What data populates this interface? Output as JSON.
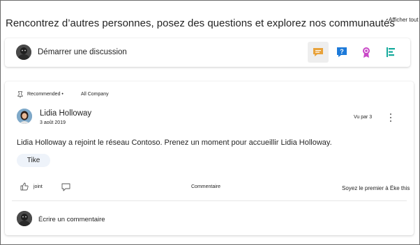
{
  "header": {
    "title": "Rencontrez d’autres personnes, posez des questions et explorez nos communautés",
    "see_all_label": "Afficher tout"
  },
  "composer": {
    "start_discussion_label": "Démarrer une discussion",
    "actions": [
      {
        "name": "discussion-icon",
        "color": "#e8a23a"
      },
      {
        "name": "question-icon",
        "color": "#1d7ad9"
      },
      {
        "name": "praise-icon",
        "color": "#c948c7"
      },
      {
        "name": "poll-icon",
        "color": "#13a99b"
      }
    ]
  },
  "post": {
    "recommended_label": "Recommended •",
    "group_label": "All Company",
    "author_name": "Lidia Holloway",
    "date": "3 août 2019",
    "seen_by": "Vu par 3",
    "body": "Lidia Holloway a rejoint le réseau Contoso. Prenez un moment pour accueillir Lidia Holloway.",
    "tag": "Tike",
    "like_label": "joint",
    "comment_label": "Commentaire",
    "first_like_text": "Soyez le premier à Ёke this",
    "write_comment_placeholder": "Écrire un commentaire"
  }
}
